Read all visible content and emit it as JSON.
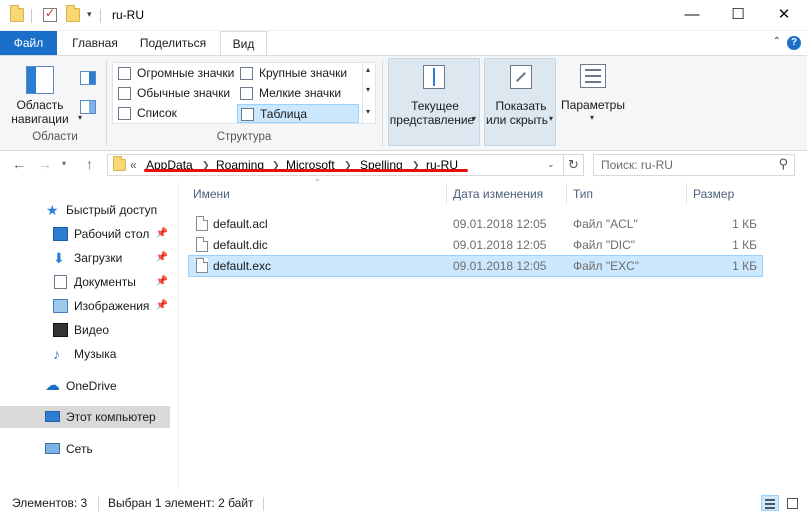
{
  "window": {
    "title": "ru-RU",
    "minimize": "—",
    "maximize": "☐",
    "close": "✕"
  },
  "tabs": {
    "file": "Файл",
    "home": "Главная",
    "share": "Поделиться",
    "view": "Вид",
    "collapse": "⌃",
    "help": "?"
  },
  "ribbon": {
    "panes_group": "Области",
    "nav_pane_line1": "Область",
    "nav_pane_line2": "навигации",
    "layout_group": "Структура",
    "layout_items": [
      "Огромные значки",
      "Крупные значки",
      "Обычные значки",
      "Мелкие значки",
      "Список",
      "Таблица"
    ],
    "current_view_line1": "Текущее",
    "current_view_line2": "представление",
    "show_hide_line1": "Показать",
    "show_hide_line2": "или скрыть",
    "options": "Параметры"
  },
  "address": {
    "overflow": "«",
    "crumbs": [
      "AppData",
      "Roaming",
      "Microsoft",
      "Spelling",
      "ru-RU"
    ],
    "search_placeholder": "Поиск: ru-RU"
  },
  "nav_pane": {
    "quick_access": "Быстрый доступ",
    "items": [
      "Рабочий стол",
      "Загрузки",
      "Документы",
      "Изображения",
      "Видео",
      "Музыка"
    ],
    "onedrive": "OneDrive",
    "this_pc": "Этот компьютер",
    "network": "Сеть"
  },
  "columns": {
    "name": "Имени",
    "date": "Дата изменения",
    "type": "Тип",
    "size": "Размер"
  },
  "files": [
    {
      "name": "default.acl",
      "date": "09.01.2018 12:05",
      "type": "Файл \"ACL\"",
      "size": "1 КБ"
    },
    {
      "name": "default.dic",
      "date": "09.01.2018 12:05",
      "type": "Файл \"DIC\"",
      "size": "1 КБ"
    },
    {
      "name": "default.exc",
      "date": "09.01.2018 12:05",
      "type": "Файл \"EXC\"",
      "size": "1 КБ"
    }
  ],
  "status": {
    "count": "Элементов: 3",
    "selection": "Выбран 1 элемент: 2 байт"
  },
  "colors": {
    "accent": "#1a6fc9",
    "selection": "#cce8ff",
    "annotation": "#e3100d"
  }
}
